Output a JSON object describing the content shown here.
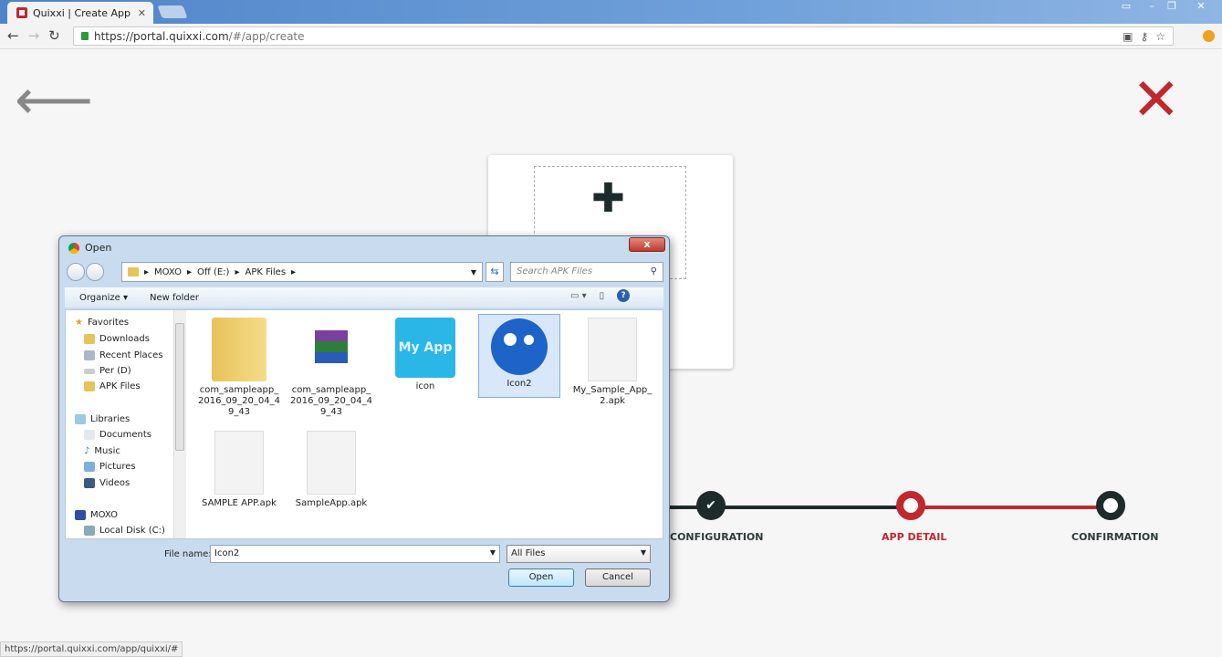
{
  "browser": {
    "tab_title": "Quixxi | Create App",
    "url_host": "https://portal.quixxi.com",
    "url_path": "/#/app/create",
    "status_url": "https://portal.quixxi.com/app/quixxi/#"
  },
  "page": {
    "stepper": [
      {
        "label": "CONFIGURATION",
        "state": "done"
      },
      {
        "label": "APP DETAIL",
        "state": "active"
      },
      {
        "label": "CONFIRMATION",
        "state": "pending"
      }
    ],
    "accent": "#c0282e",
    "dark": "#1e2b2b"
  },
  "dialog": {
    "title": "Open",
    "breadcrumb": [
      "MOXO",
      "Off (E:)",
      "APK Files"
    ],
    "search_placeholder": "Search APK Files",
    "organize": "Organize",
    "new_folder": "New folder",
    "tree": {
      "favorites": "Favorites",
      "fav_items": [
        "Downloads",
        "Recent Places",
        "Per (D)",
        "APK Files"
      ],
      "libraries": "Libraries",
      "lib_items": [
        "Documents",
        "Music",
        "Pictures",
        "Videos"
      ],
      "computer": "MOXO",
      "comp_items": [
        "Local Disk (C:)"
      ]
    },
    "files": [
      {
        "name": "com_sampleapp_2016_09_20_04_49_43",
        "type": "folder"
      },
      {
        "name": "com_sampleapp_2016_09_20_04_49_43",
        "type": "archive"
      },
      {
        "name": "icon",
        "type": "image"
      },
      {
        "name": "Icon2",
        "type": "image-robot",
        "selected": true
      },
      {
        "name": "My_Sample_App_2.apk",
        "type": "file"
      },
      {
        "name": "SAMPLE APP.apk",
        "type": "file"
      },
      {
        "name": "SampleApp.apk",
        "type": "file"
      }
    ],
    "my_app_text": "My App",
    "file_name_label": "File name:",
    "file_name": "Icon2",
    "file_type": "All Files",
    "open": "Open",
    "cancel": "Cancel"
  }
}
